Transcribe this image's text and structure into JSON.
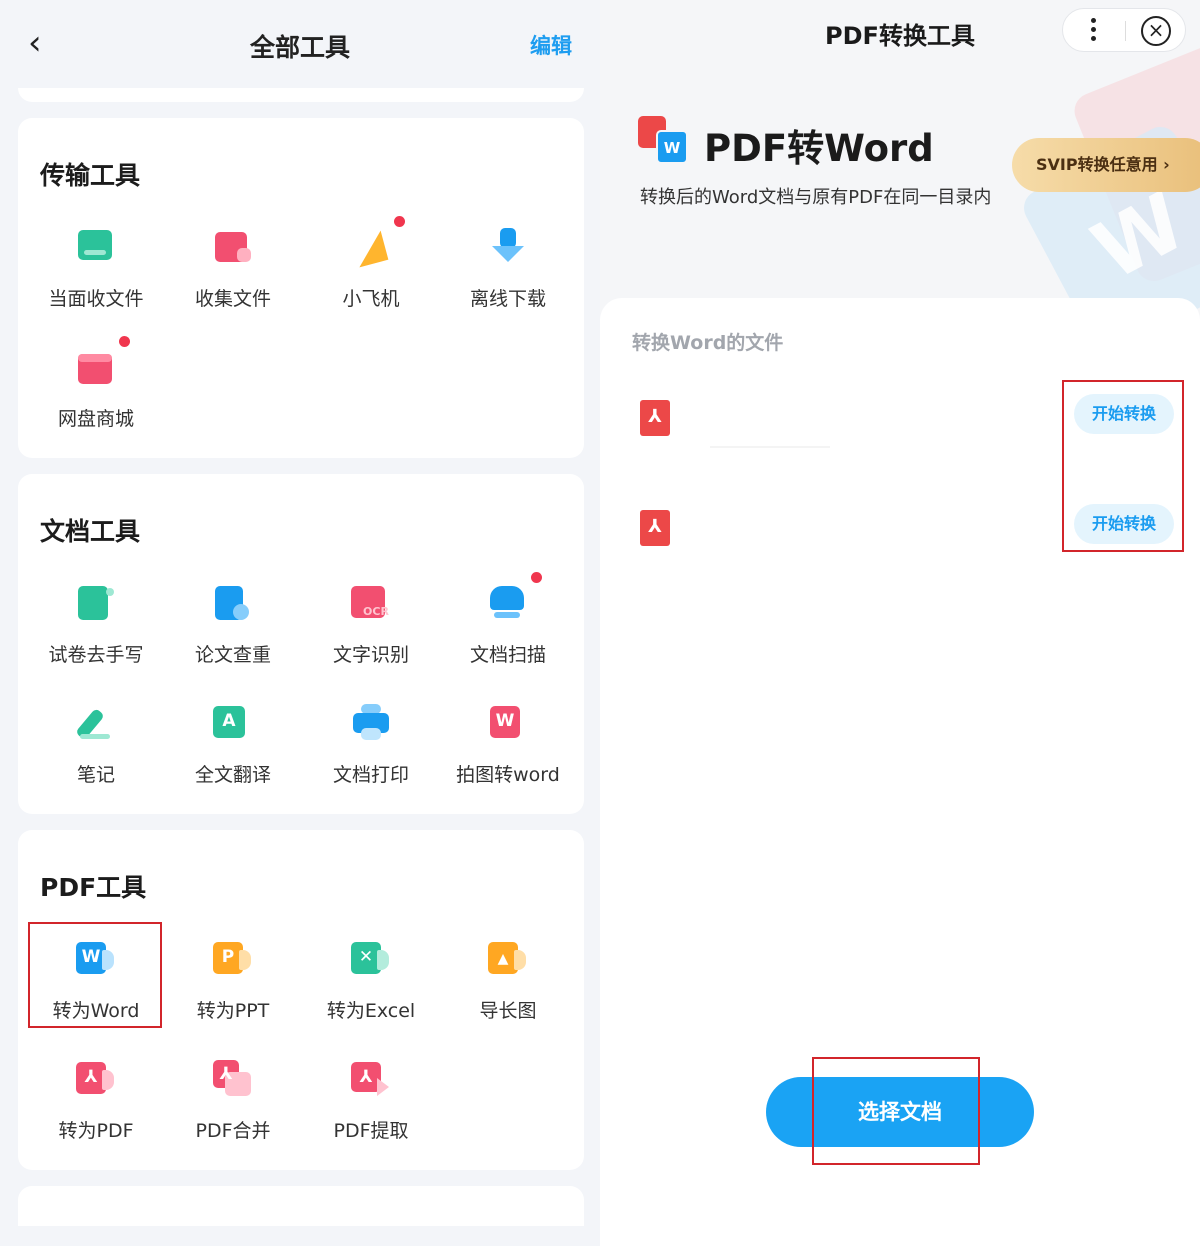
{
  "left": {
    "back_glyph": "‹",
    "title": "全部工具",
    "edit_label": "编辑",
    "sections": [
      {
        "title": "传输工具",
        "items": [
          {
            "label": "当面收文件",
            "icon": "receive-icon"
          },
          {
            "label": "收集文件",
            "icon": "collect-folder-icon"
          },
          {
            "label": "小飞机",
            "icon": "paper-plane-icon",
            "badge": true
          },
          {
            "label": "离线下载",
            "icon": "download-icon"
          },
          {
            "label": "网盘商城",
            "icon": "store-icon",
            "badge": true
          }
        ]
      },
      {
        "title": "文档工具",
        "items": [
          {
            "label": "试卷去手写",
            "icon": "erase-handwriting-icon"
          },
          {
            "label": "论文查重",
            "icon": "paper-check-icon"
          },
          {
            "label": "文字识别",
            "icon": "ocr-icon",
            "icon_text": "OCR"
          },
          {
            "label": "文档扫描",
            "icon": "scan-icon",
            "badge": true
          },
          {
            "label": "笔记",
            "icon": "note-pen-icon"
          },
          {
            "label": "全文翻译",
            "icon": "translate-icon",
            "icon_text": "A"
          },
          {
            "label": "文档打印",
            "icon": "printer-icon"
          },
          {
            "label": "拍图转word",
            "icon": "photo-to-word-icon",
            "icon_text": "W"
          }
        ]
      },
      {
        "title": "PDF工具",
        "items": [
          {
            "label": "转为Word",
            "icon": "to-word-icon",
            "icon_text": "W"
          },
          {
            "label": "转为PPT",
            "icon": "to-ppt-icon",
            "icon_text": "P"
          },
          {
            "label": "转为Excel",
            "icon": "to-excel-icon",
            "icon_text": "✕"
          },
          {
            "label": "导长图",
            "icon": "long-image-icon",
            "icon_text": "▲"
          },
          {
            "label": "转为PDF",
            "icon": "to-pdf-icon",
            "icon_text": "⅄"
          },
          {
            "label": "PDF合并",
            "icon": "pdf-merge-icon",
            "icon_text": "⅄"
          },
          {
            "label": "PDF提取",
            "icon": "pdf-extract-icon",
            "icon_text": "⅄"
          }
        ]
      }
    ]
  },
  "right": {
    "title": "PDF转换工具",
    "menu_icon": "more-vertical-icon",
    "close_glyph": "×",
    "hero_title": "PDF转Word",
    "hero_subtitle": "转换后的Word文档与原有PDF在同一目录内",
    "hero_icon_text": "W",
    "svip_label": "SVIP转换任意用 ›",
    "list_label": "转换Word的文件",
    "files": [
      {
        "icon_glyph": "⅄",
        "action": "开始转换"
      },
      {
        "icon_glyph": "⅄",
        "action": "开始转换"
      }
    ],
    "choose_label": "选择文档"
  },
  "colors": {
    "accent": "#1aa3f4",
    "edit": "#1e9df0",
    "badge": "#f0364e",
    "pdf_red": "#ec4848",
    "highlight": "#d2252b"
  }
}
